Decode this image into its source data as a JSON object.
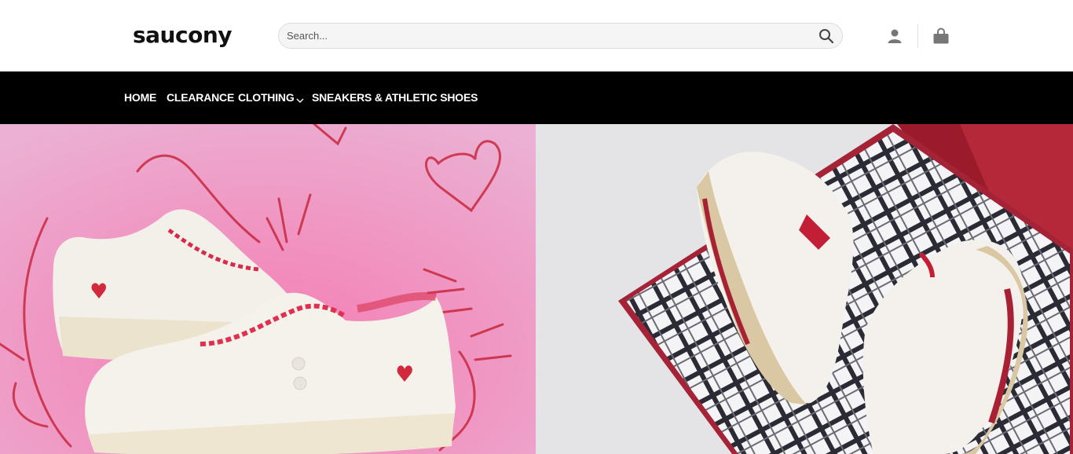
{
  "header": {
    "logo": "saucony",
    "search_placeholder": "Search...",
    "icons": [
      "search-icon",
      "account-icon",
      "cart-icon"
    ]
  },
  "nav": {
    "items": [
      {
        "label": "HOME"
      },
      {
        "label": "CLEARANCE"
      },
      {
        "label": "CLOTHING",
        "icon": "chevron-down-icon"
      },
      {
        "label": "SNEAKERS & ATHLETIC SHOES"
      }
    ]
  },
  "hero": {
    "left": {
      "image": "white-sneakers-with-red-hearts-on-pink"
    },
    "right": {
      "image": "white-gold-running-shoes-on-plaid-box"
    }
  },
  "colors": {
    "nav_bg": "#000000",
    "hero_left_bg": "#f0a8cc",
    "hero_right_bg": "#e4e3e6",
    "accent_red": "#c41e3a"
  }
}
